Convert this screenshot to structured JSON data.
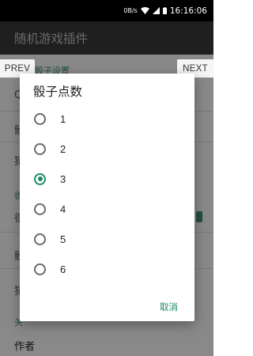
{
  "status_bar": {
    "net_speed": "0B/s",
    "time": "16:16:06"
  },
  "app_bar": {
    "title": "随机游戏插件"
  },
  "background": {
    "items": [
      "Q",
      "骰",
      "猜",
      "德",
      "骰",
      "猜"
    ],
    "section_labels": [
      "骰子设置",
      "德州",
      "关"
    ],
    "footer_title": "作者"
  },
  "nav": {
    "prev": "PREV",
    "next": "NEXT"
  },
  "dialog": {
    "title": "骰子点数",
    "options": [
      "1",
      "2",
      "3",
      "4",
      "5",
      "6"
    ],
    "selected": "3",
    "cancel": "取消"
  },
  "colors": {
    "accent": "#1f8a63",
    "app_bar": "#1f1f1f"
  }
}
